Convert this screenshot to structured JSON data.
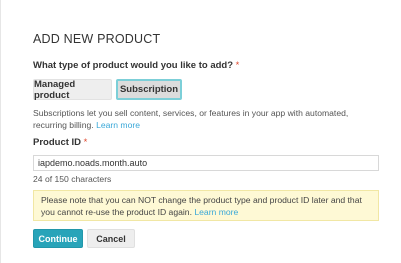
{
  "dialog": {
    "title": "ADD NEW PRODUCT",
    "question": "What type of product would you like to add?",
    "required_mark": "*",
    "product_types": [
      {
        "label": "Managed product",
        "selected": false
      },
      {
        "label": "Subscription",
        "selected": true
      }
    ],
    "description": "Subscriptions let you sell content, services, or features in your app with automated, recurring billing.",
    "learn_more": "Learn more",
    "product_id_label": "Product ID",
    "product_id_value": "iapdemo.noads.month.auto",
    "char_count": "24 of 150 characters",
    "notice_text": "Please note that you can NOT change the product type and product ID later and that you cannot re-use the product ID again.",
    "notice_link": "Learn more",
    "continue_label": "Continue",
    "cancel_label": "Cancel"
  },
  "colors": {
    "accent": "#28a4b9",
    "link": "#3aa8d8",
    "required": "#e0492f",
    "selected_border": "#7ccfd8",
    "notice_bg": "#fef9d5"
  }
}
